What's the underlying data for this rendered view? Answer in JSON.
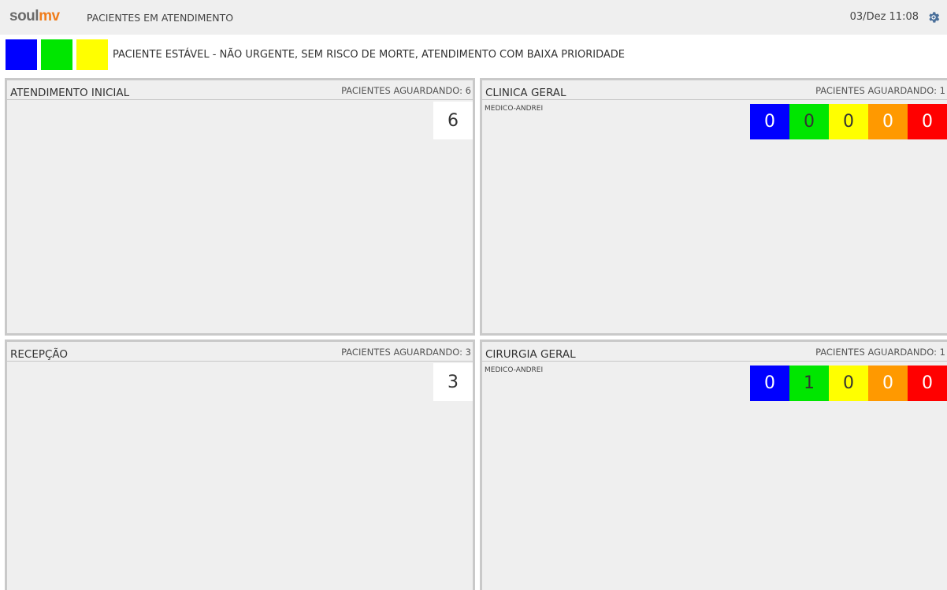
{
  "header": {
    "logo_part1": "soul",
    "logo_part2": "mv",
    "title": "PACIENTES EM ATENDIMENTO",
    "datetime": "03/Dez 11:08",
    "settings_icon": "gear-icon"
  },
  "legend": {
    "colors": [
      "#0000ff",
      "#00e600",
      "#ffff00"
    ],
    "description": "PACIENTE ESTÁVEL - NÃO URGENTE, SEM RISCO DE MORTE, ATENDIMENTO COM BAIXA PRIORIDADE"
  },
  "panels": [
    {
      "title": "ATENDIMENTO INICIAL",
      "waiting": "PACIENTES AGUARDANDO: 6",
      "total": "6"
    },
    {
      "title": "CLINICA GERAL",
      "waiting": "PACIENTES AGUARDANDO: 1",
      "doctor": "MEDICO-ANDREI",
      "priorities": [
        {
          "value": "0",
          "color": "#0000ff",
          "text_color": "#ffffff"
        },
        {
          "value": "0",
          "color": "#00e600",
          "text_color": "#333333"
        },
        {
          "value": "0",
          "color": "#ffff00",
          "text_color": "#333333"
        },
        {
          "value": "0",
          "color": "#ff9900",
          "text_color": "#ffffff"
        },
        {
          "value": "0",
          "color": "#ff0000",
          "text_color": "#ffffff"
        }
      ]
    },
    {
      "title": "RECEPÇÃO",
      "waiting": "PACIENTES AGUARDANDO: 3",
      "total": "3"
    },
    {
      "title": "CIRURGIA GERAL",
      "waiting": "PACIENTES AGUARDANDO: 1",
      "doctor": "MEDICO-ANDREI",
      "priorities": [
        {
          "value": "0",
          "color": "#0000ff",
          "text_color": "#ffffff"
        },
        {
          "value": "1",
          "color": "#00e600",
          "text_color": "#333333"
        },
        {
          "value": "0",
          "color": "#ffff00",
          "text_color": "#333333"
        },
        {
          "value": "0",
          "color": "#ff9900",
          "text_color": "#ffffff"
        },
        {
          "value": "0",
          "color": "#ff0000",
          "text_color": "#ffffff"
        }
      ]
    }
  ]
}
